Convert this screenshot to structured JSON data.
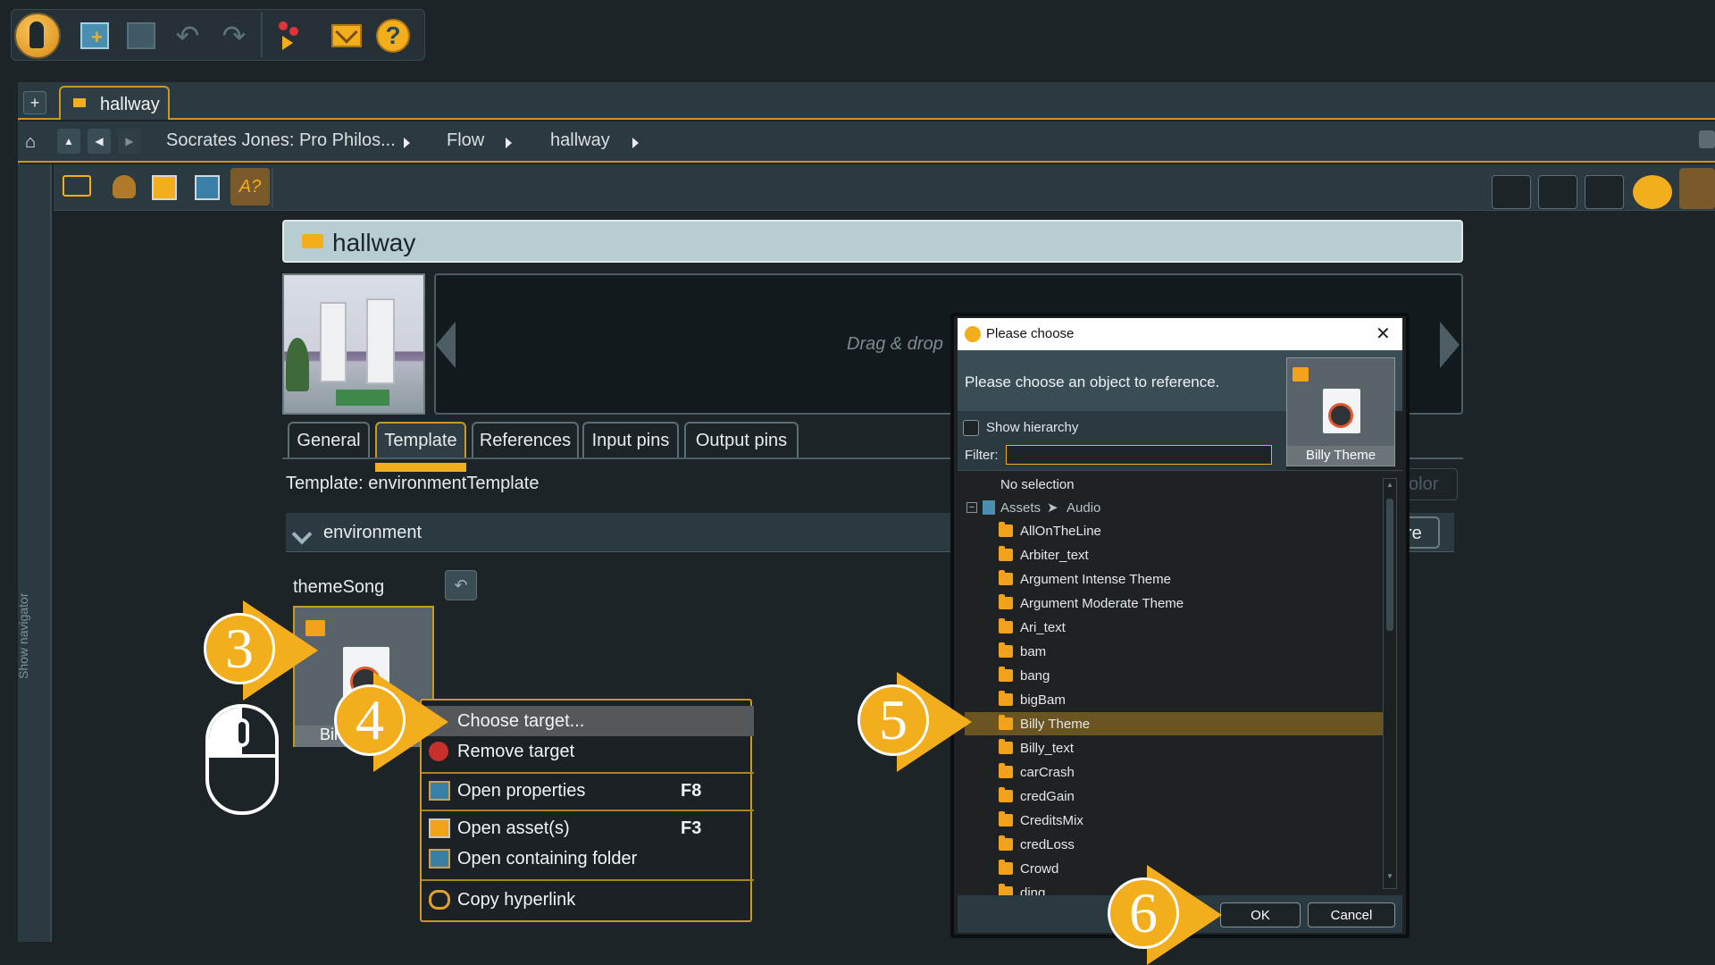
{
  "colors": {
    "accent": "#f2ae1c",
    "panel": "#2a3a40",
    "dialog_bg": "#1e2224",
    "title_bar": "#b7cdd2",
    "selected_row": "#6a5421"
  },
  "toolbar": {
    "icons": [
      "app-logo-icon",
      "new-document-icon",
      "save-icon",
      "undo-icon",
      "redo-icon",
      "pins-icon",
      "mail-icon",
      "help-icon"
    ],
    "help_glyph": "?"
  },
  "tabs_bar": {
    "add_label": "+",
    "active_tab": "hallway"
  },
  "breadcrumb": {
    "items": [
      "Socrates Jones: Pro Philos...",
      "Flow",
      "hallway"
    ]
  },
  "navigator": {
    "label": "Show navigator"
  },
  "object": {
    "title": "hallway",
    "drop_hint": "Drag & drop"
  },
  "property_tabs": [
    "General",
    "Template",
    "References",
    "Input pins",
    "Output pins"
  ],
  "template": {
    "label": "Template: environmentTemplate",
    "section": "environment",
    "field": "themeSong",
    "thumb_label": "Bil",
    "partial_color_btn": "olor",
    "partial_btn": "re"
  },
  "context_menu": {
    "items": [
      {
        "label": "Choose target...",
        "shortcut": ""
      },
      {
        "label": "Remove target",
        "shortcut": ""
      },
      {
        "label": "Open properties",
        "shortcut": "F8"
      },
      {
        "label": "Open asset(s)",
        "shortcut": "F3"
      },
      {
        "label": "Open containing folder",
        "shortcut": ""
      },
      {
        "label": "Copy hyperlink",
        "shortcut": ""
      }
    ]
  },
  "dialog": {
    "title": "Please choose",
    "close": "✕",
    "prompt": "Please choose an object to reference.",
    "preview_label": "Billy Theme",
    "show_hierarchy": "Show hierarchy",
    "filter_label": "Filter:",
    "filter_value": "",
    "no_selection": "No selection",
    "path": [
      "Assets",
      "Audio"
    ],
    "items": [
      "AllOnTheLine",
      "Arbiter_text",
      "Argument Intense Theme",
      "Argument Moderate Theme",
      "Ari_text",
      "bam",
      "bang",
      "bigBam",
      "Billy Theme",
      "Billy_text",
      "carCrash",
      "credGain",
      "CreditsMix",
      "credLoss",
      "Crowd",
      "ding"
    ],
    "selected_item": "Billy Theme",
    "ok": "OK",
    "cancel": "Cancel"
  },
  "step_badges": [
    "3",
    "4",
    "5",
    "6"
  ]
}
